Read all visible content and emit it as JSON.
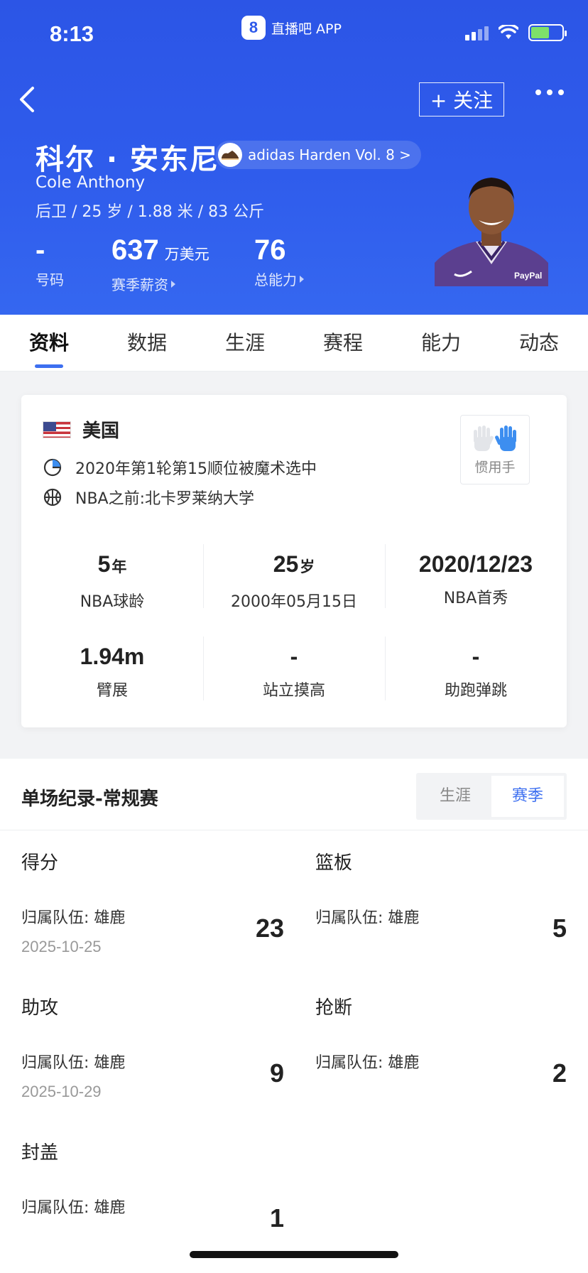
{
  "status_bar": {
    "time": "8:13",
    "app_badge_logo": "8",
    "app_badge_text": "直播吧 APP"
  },
  "header": {
    "follow_label": "+ 关注",
    "name_cn": "科尔 · 安东尼",
    "shoe": "adidas Harden Vol. 8 >",
    "name_en": "Cole Anthony",
    "bio": "后卫 / 25 岁 / 1.88 米 / 83 公斤",
    "stats": [
      {
        "value": "-",
        "unit": "",
        "label": "号码"
      },
      {
        "value": "637",
        "unit": "万美元",
        "label": "赛季薪资"
      },
      {
        "value": "76",
        "unit": "",
        "label": "总能力"
      }
    ],
    "photo_text": "PayPal"
  },
  "tabs": [
    "资料",
    "数据",
    "生涯",
    "赛程",
    "能力",
    "动态"
  ],
  "profile": {
    "country": "美国",
    "draft": "2020年第1轮第15顺位被魔术选中",
    "college": "NBA之前:北卡罗莱纳大学",
    "hand_label": "惯用手",
    "grid": [
      {
        "value": "5",
        "unit": "年",
        "label": "NBA球龄"
      },
      {
        "value": "25",
        "unit": "岁",
        "label": "2000年05月15日"
      },
      {
        "value": "2020/12/23",
        "unit": "",
        "label": "NBA首秀"
      },
      {
        "value": "1.94m",
        "unit": "",
        "label": "臂展"
      },
      {
        "value": "-",
        "unit": "",
        "label": "站立摸高"
      },
      {
        "value": "-",
        "unit": "",
        "label": "助跑弹跳"
      }
    ]
  },
  "records": {
    "title": "单场纪录-常规赛",
    "toggle": [
      "生涯",
      "赛季"
    ],
    "items": [
      {
        "label": "得分",
        "team": "归属队伍:  雄鹿",
        "date": "2025-10-25",
        "value": "23"
      },
      {
        "label": "篮板",
        "team": "归属队伍:  雄鹿",
        "date": "",
        "value": "5"
      },
      {
        "label": "助攻",
        "team": "归属队伍:  雄鹿",
        "date": "2025-10-29",
        "value": "9"
      },
      {
        "label": "抢断",
        "team": "归属队伍:  雄鹿",
        "date": "",
        "value": "2"
      },
      {
        "label": "封盖",
        "team": "归属队伍:  雄鹿",
        "date": "",
        "value": "1"
      }
    ]
  },
  "colors": {
    "header_blue": "#2f5cec",
    "accent": "#3d6ff0",
    "hand_blue": "#3d8ef0"
  },
  "icons": [
    "back-icon",
    "more-icon",
    "shoe-icon",
    "flag-icon",
    "draft-icon",
    "basketball-icon",
    "hand-icon"
  ]
}
